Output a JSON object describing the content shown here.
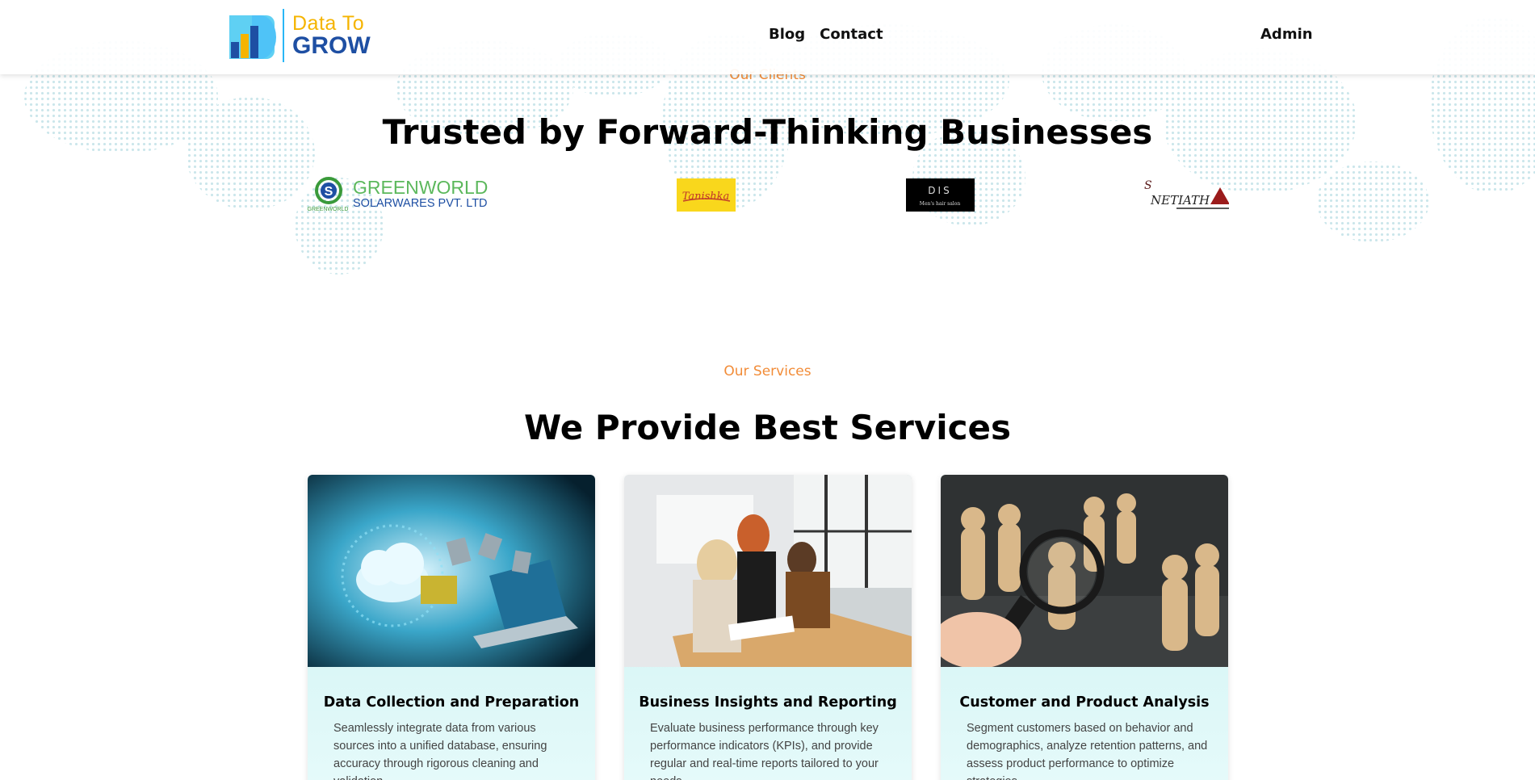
{
  "header": {
    "logo": {
      "line1": "Data To",
      "line2": "GROW"
    },
    "nav": [
      {
        "label": "Blog"
      },
      {
        "label": "Contact"
      }
    ],
    "admin_label": "Admin"
  },
  "clients": {
    "eyebrow": "Our Clients",
    "heading": "Trusted by Forward-Thinking Businesses",
    "logos": [
      {
        "name": "GREENWORLD",
        "line2": "SOLARWARES PVT. LTD",
        "small": "GREENWORLD",
        "mark": "S"
      },
      {
        "name": "Tanishka"
      },
      {
        "name": "DIS",
        "sub": "Men's hair salon"
      },
      {
        "name": "NETIATH",
        "prefix": "S"
      }
    ]
  },
  "services": {
    "eyebrow": "Our Services",
    "heading": "We Provide Best Services",
    "cards": [
      {
        "title": "Data Collection and Preparation",
        "description": "Seamlessly integrate data from various sources into a unified database, ensuring accuracy through rigorous cleaning and validation."
      },
      {
        "title": "Business Insights and Reporting",
        "description": "Evaluate business performance through key performance indicators (KPIs), and provide regular and real-time reports tailored to your needs."
      },
      {
        "title": "Customer and Product Analysis",
        "description": "Segment customers based on behavior and demographics, analyze retention patterns, and assess product performance to optimize strategies."
      }
    ]
  },
  "colors": {
    "accent_orange": "#f28c38",
    "logo_blue": "#1e4fa3",
    "logo_yellow": "#f5b400",
    "card_bg": "#c9f1f1"
  }
}
